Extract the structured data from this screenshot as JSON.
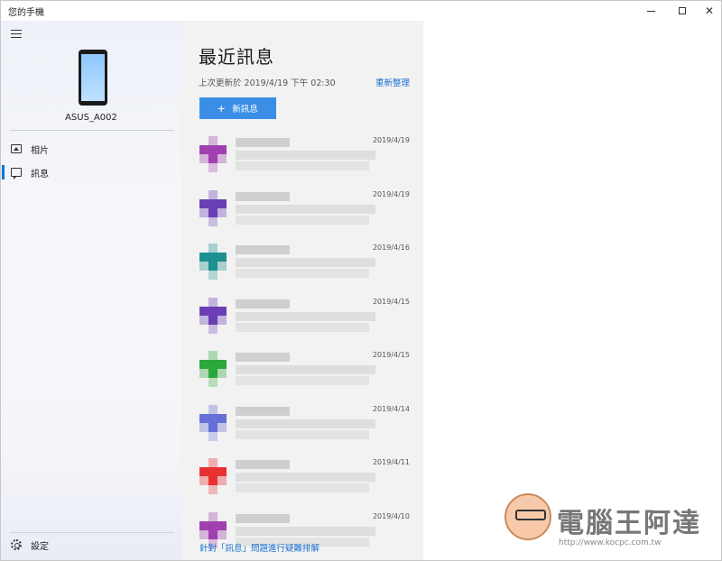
{
  "window": {
    "title": "您的手機",
    "controls": {
      "minimize_icon": "minimize-icon",
      "maximize_icon": "maximize-icon",
      "close_label": "✕"
    }
  },
  "nav": {
    "menu_icon": "hamburger-icon",
    "device_name": "ASUS_A002",
    "items": [
      {
        "label": "相片",
        "icon": "photos-icon"
      },
      {
        "label": "訊息",
        "icon": "message-icon",
        "selected": true
      }
    ],
    "settings_label": "設定",
    "settings_icon": "gear-icon"
  },
  "messages": {
    "title": "最近訊息",
    "last_updated": "上次更新於 2019/4/19 下午 02:30",
    "refresh_label": "重新整理",
    "new_message_label": "新訊息",
    "conversations": [
      {
        "date": "2019/4/19",
        "color": "#a040b0"
      },
      {
        "date": "2019/4/19",
        "color": "#6a3fb5"
      },
      {
        "date": "2019/4/16",
        "color": "#1f9090"
      },
      {
        "date": "2019/4/15",
        "color": "#6a3fb5"
      },
      {
        "date": "2019/4/15",
        "color": "#2aa83a"
      },
      {
        "date": "2019/4/14",
        "color": "#6670d6"
      },
      {
        "date": "2019/4/11",
        "color": "#e83030"
      },
      {
        "date": "2019/4/10",
        "color": "#a040b0"
      }
    ],
    "troubleshoot_link": "針對「訊息」問題進行疑難排解"
  },
  "watermark": {
    "text": "電腦王阿達",
    "url": "http://www.kocpc.com.tw"
  },
  "colors": {
    "accent": "#0078d7",
    "button": "#3b8ee6",
    "link": "#1a73d1"
  }
}
